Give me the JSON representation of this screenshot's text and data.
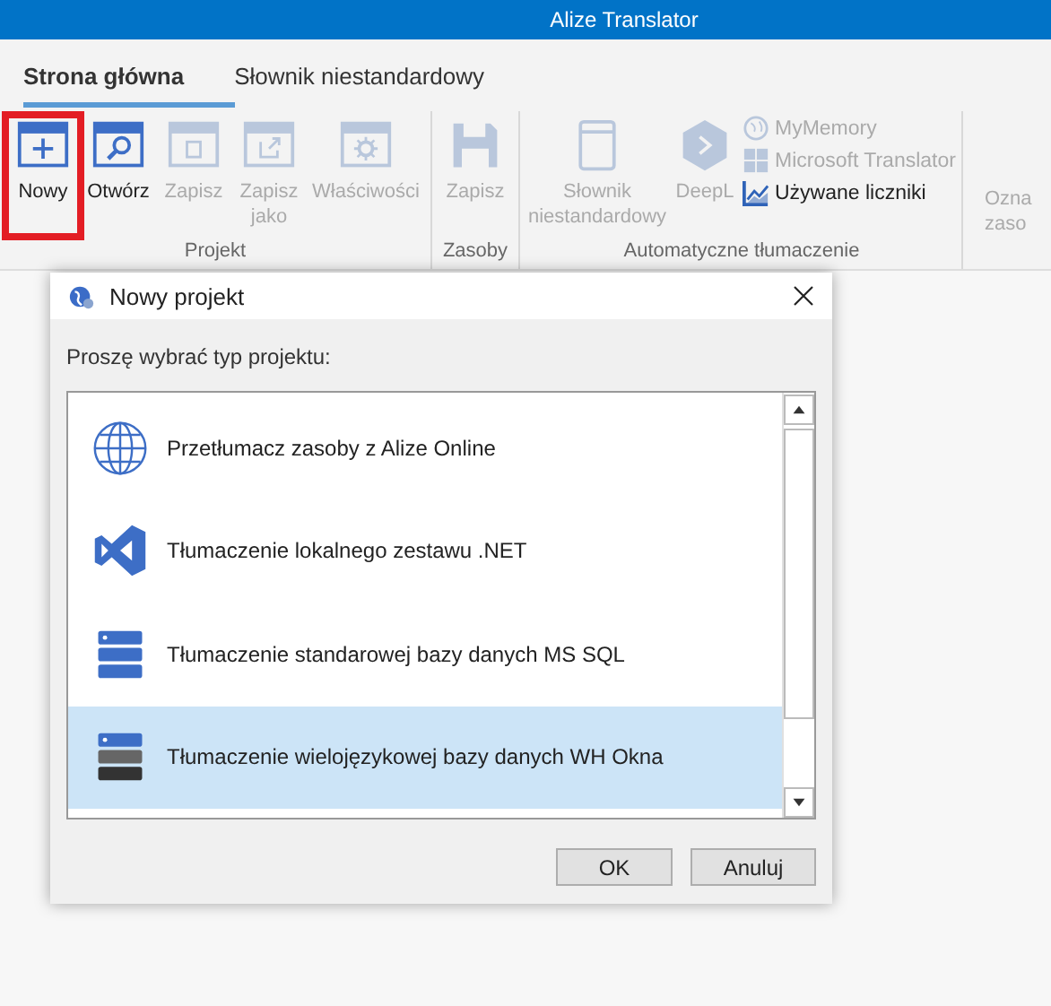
{
  "window": {
    "title": "Alize Translator"
  },
  "tabs": [
    {
      "label": "Strona główna",
      "selected": true
    },
    {
      "label": "Słownik niestandardowy",
      "selected": false
    }
  ],
  "ribbon_groups": [
    {
      "label": "Projekt",
      "items": [
        {
          "kind": "large",
          "label": "Nowy",
          "disabled": false,
          "highlighted": true
        },
        {
          "kind": "large",
          "label": "Otwórz",
          "disabled": false,
          "highlighted": false
        },
        {
          "kind": "large",
          "label": "Zapisz",
          "disabled": true,
          "highlighted": false
        },
        {
          "kind": "large",
          "label": "Zapisz jako",
          "disabled": true,
          "highlighted": false
        },
        {
          "kind": "large",
          "label": "Właściwości",
          "disabled": true,
          "highlighted": false
        }
      ]
    },
    {
      "label": "Zasoby",
      "items": [
        {
          "kind": "large",
          "label": "Zapisz",
          "disabled": true,
          "highlighted": false
        }
      ]
    },
    {
      "label": "Automatyczne tłumaczenie",
      "items": [
        {
          "kind": "large",
          "label": "Słownik niestandardowy",
          "disabled": true,
          "highlighted": false
        },
        {
          "kind": "large",
          "label": "DeepL",
          "disabled": true,
          "highlighted": false
        },
        {
          "kind": "small",
          "label": "MyMemory",
          "disabled": true
        },
        {
          "kind": "small",
          "label": "Microsoft Translator",
          "disabled": true
        },
        {
          "kind": "small",
          "label": "Używane liczniki",
          "disabled": false
        }
      ]
    },
    {
      "items": [
        {
          "kind": "large",
          "label": "Ozna zaso",
          "disabled": true,
          "highlighted": false
        }
      ]
    }
  ],
  "dialog": {
    "title": "Nowy projekt",
    "prompt": "Proszę wybrać typ projektu:",
    "options": [
      {
        "label": "Przetłumacz zasoby z Alize Online",
        "selected": false
      },
      {
        "label": "Tłumaczenie lokalnego zestawu .NET",
        "selected": false
      },
      {
        "label": "Tłumaczenie standarowej bazy danych MS SQL",
        "selected": false
      },
      {
        "label": "Tłumaczenie wielojęzykowej bazy danych WH Okna",
        "selected": true
      }
    ],
    "buttons": [
      "OK",
      "Anuluj"
    ]
  }
}
